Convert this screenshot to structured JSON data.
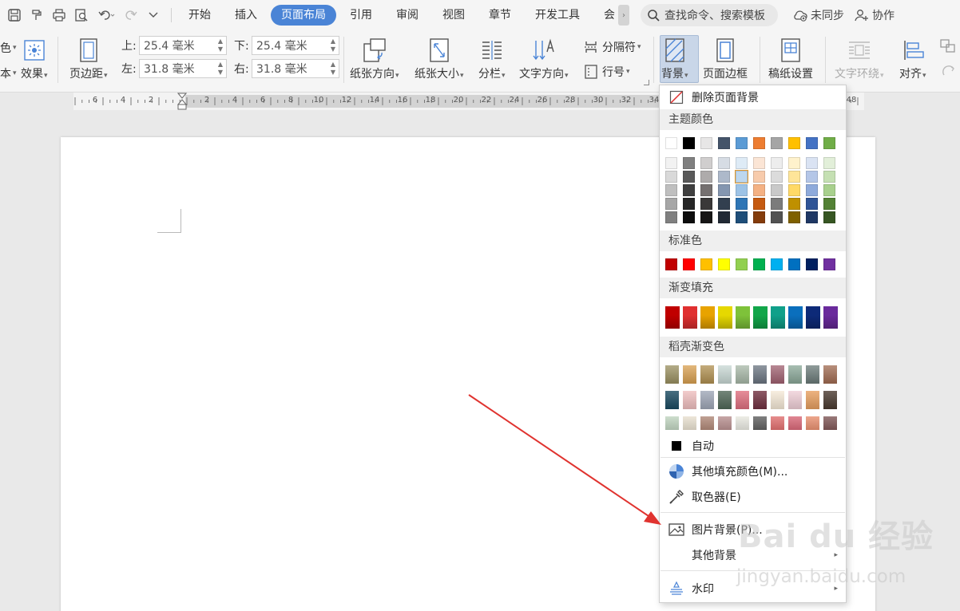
{
  "tabbar": {
    "tabs": [
      "开始",
      "插入",
      "页面布局",
      "引用",
      "审阅",
      "视图",
      "章节",
      "开发工具",
      "会"
    ],
    "active_tab": "页面布局",
    "search_label": "查找命令、搜索模板",
    "sync_label": "未同步",
    "collab_label": "协作"
  },
  "ribbon": {
    "partial_left_1": "色",
    "partial_left_2": "本",
    "effects": "效果",
    "margins": "页边距",
    "margin_top_label": "上:",
    "margin_top_value": "25.4 毫米",
    "margin_left_label": "左:",
    "margin_left_value": "31.8 毫米",
    "margin_bottom_label": "下:",
    "margin_bottom_value": "25.4 毫米",
    "margin_right_label": "右:",
    "margin_right_value": "31.8 毫米",
    "orientation": "纸张方向",
    "size": "纸张大小",
    "columns": "分栏",
    "text_direction": "文字方向",
    "breaks": "分隔符",
    "line_numbers": "行号",
    "background": "背景",
    "page_borders": "页面边框",
    "manuscript": "稿纸设置",
    "text_wrap": "文字环绕",
    "align": "对齐"
  },
  "ruler": {
    "numbers": [
      "6",
      "4",
      "2",
      "2",
      "4",
      "6",
      "8",
      "10",
      "12",
      "14",
      "16",
      "18",
      "20",
      "22",
      "24",
      "26",
      "28",
      "30",
      "32",
      "34",
      "48"
    ]
  },
  "menu": {
    "remove_bg": "删除页面背景",
    "theme_colors": "主题颜色",
    "standard_colors": "标准色",
    "gradient_fill": "渐变填充",
    "docer_gradient": "稻壳渐变色",
    "auto": "自动",
    "more_colors": "其他填充颜色(M)...",
    "eyedropper": "取色器(E)",
    "picture_bg": "图片背景(P)...",
    "other_bg": "其他背景",
    "watermark": "水印",
    "theme_row": [
      "#ffffff",
      "#000000",
      "#e7e6e6",
      "#44546a",
      "#5b9bd5",
      "#ed7d31",
      "#a5a5a5",
      "#ffc000",
      "#4472c4",
      "#70ad47"
    ],
    "theme_grid": [
      [
        "#f2f2f2",
        "#7f7f7f",
        "#d0cece",
        "#d6dce4",
        "#deebf6",
        "#fbe5d5",
        "#ededed",
        "#fff2cc",
        "#dae3f3",
        "#e2efd9"
      ],
      [
        "#d9d9d9",
        "#595959",
        "#aeabab",
        "#adb9ca",
        "#bdd7ee",
        "#f7cbac",
        "#dbdbdb",
        "#fee599",
        "#b4c6e7",
        "#c5e0b3"
      ],
      [
        "#bfbfbf",
        "#3f3f3f",
        "#757070",
        "#8496b0",
        "#9dc3e6",
        "#f4b183",
        "#c9c9c9",
        "#ffd966",
        "#8eaadb",
        "#a8d08d"
      ],
      [
        "#a6a6a6",
        "#262626",
        "#3a3838",
        "#323f4f",
        "#2e75b5",
        "#c55a11",
        "#7b7b7b",
        "#bf9000",
        "#2f5496",
        "#538135"
      ],
      [
        "#808080",
        "#0d0d0d",
        "#171616",
        "#222a35",
        "#1e4e79",
        "#843c0b",
        "#525252",
        "#7f6000",
        "#1f3864",
        "#375623"
      ]
    ],
    "standard_row": [
      "#c00000",
      "#ff0000",
      "#ffc000",
      "#ffff00",
      "#92d050",
      "#00b050",
      "#00b0f0",
      "#0070c0",
      "#002060",
      "#7030a0"
    ],
    "gradient_row": [
      "#c00000",
      "#e03030",
      "#e8a300",
      "#e6d800",
      "#7ec23a",
      "#12a64a",
      "#10a08a",
      "#0a6fbd",
      "#0d2a78",
      "#6a2a9c"
    ],
    "docer_row1": [
      "#9a9060",
      "#d9a050",
      "#b09050",
      "#c8d8d4",
      "#a8b8a8",
      "#6a7480",
      "#a06070",
      "#8aa898",
      "#6a7a78",
      "#a06a50"
    ],
    "docer_row2": [
      "#1a4a60",
      "#f0c0c0",
      "#a0a8b8",
      "#506858",
      "#e07080",
      "#703040",
      "#f6ead8",
      "#f0d0d8",
      "#e8a060",
      "#4a3a30"
    ],
    "docer_row3": [
      "#c0d4c0",
      "#e8e0d0",
      "#b08878",
      "#b89090",
      "#e8e8e0",
      "#606060",
      "#e07070",
      "#d86878",
      "#e89070",
      "#805858"
    ]
  },
  "watermark": {
    "logo": "Bai du 经验",
    "url": "jingyan.baidu.com"
  }
}
